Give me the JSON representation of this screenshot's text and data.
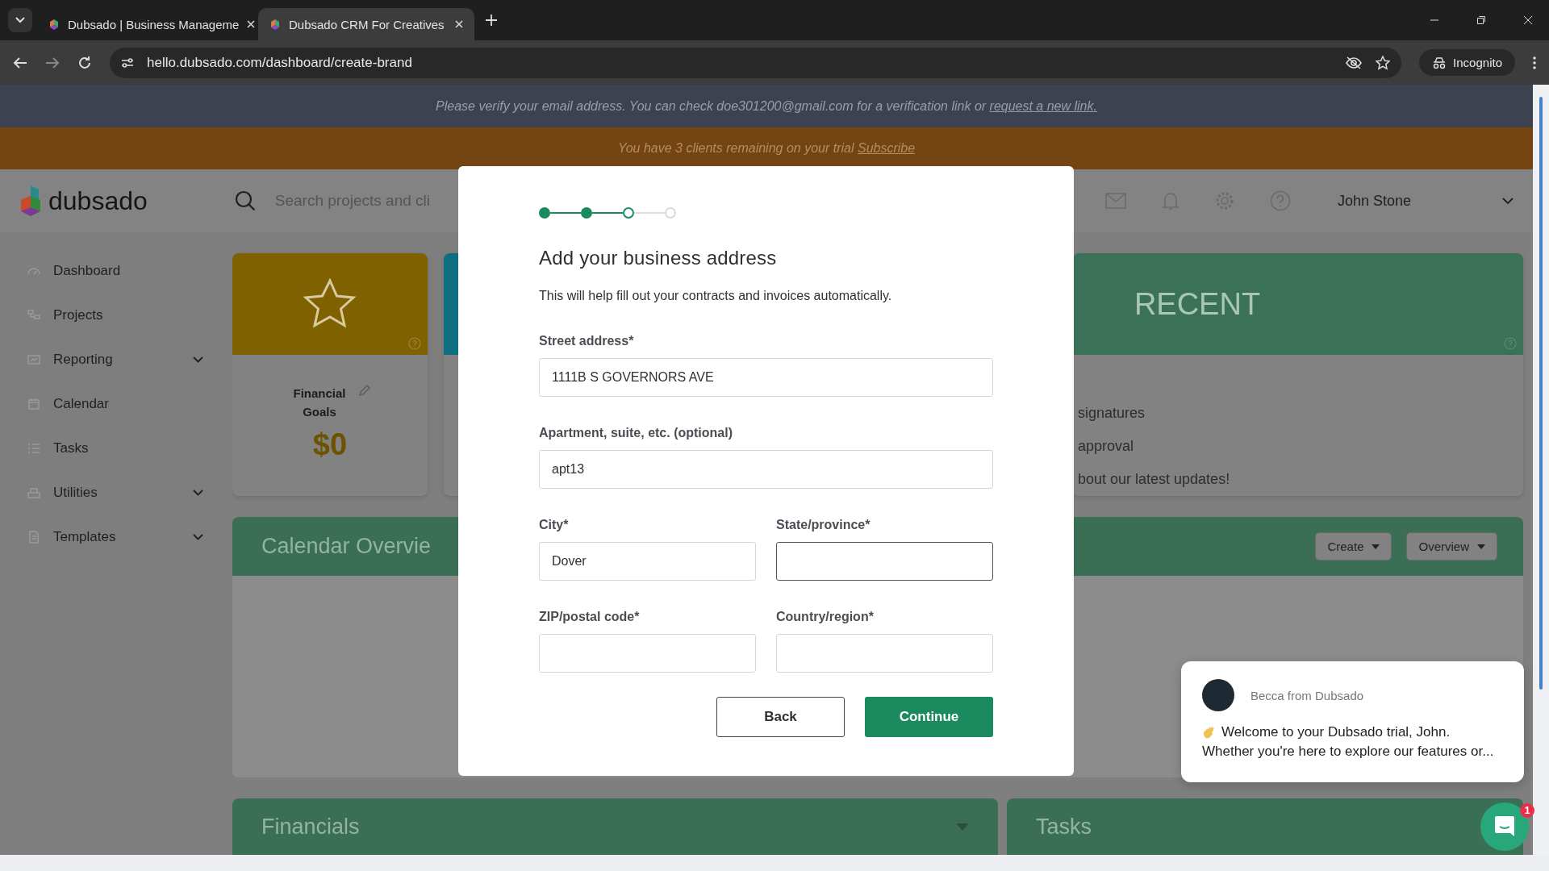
{
  "browser": {
    "tabs": [
      {
        "title": "Dubsado | Business Manageme",
        "selected": false
      },
      {
        "title": "Dubsado CRM For Creatives",
        "selected": true
      }
    ],
    "url": "hello.dubsado.com/dashboard/create-brand",
    "profile": "Incognito"
  },
  "verify_banner": {
    "text": "Please verify your email address. You can check doe301200@gmail.com for a verification link or ",
    "link": "request a new link."
  },
  "trial_banner": {
    "text": "You have 3 clients remaining on your trial ",
    "link": "Subscribe"
  },
  "header": {
    "logo": "dubsado",
    "search_placeholder": "Search projects and cli",
    "user": "John Stone"
  },
  "sidebar": {
    "items": [
      {
        "label": "Dashboard",
        "expandable": false
      },
      {
        "label": "Projects",
        "expandable": false
      },
      {
        "label": "Reporting",
        "expandable": true
      },
      {
        "label": "Calendar",
        "expandable": false
      },
      {
        "label": "Tasks",
        "expandable": false
      },
      {
        "label": "Utilities",
        "expandable": true
      },
      {
        "label": "Templates",
        "expandable": true
      }
    ]
  },
  "goal_card": {
    "title": "Financial Goals",
    "amount": "$0"
  },
  "recent_card": {
    "title": "RECENT",
    "items": [
      "signatures",
      "approval",
      "bout our latest updates!"
    ]
  },
  "calendar_panel": {
    "title": "Calendar Overvie",
    "buttons": [
      "Create",
      "Overview"
    ]
  },
  "bottom_panels": [
    "Financials",
    "Tasks"
  ],
  "modal": {
    "steps": [
      {
        "completed": true,
        "current": false
      },
      {
        "completed": true,
        "current": false
      },
      {
        "completed": false,
        "current": true
      },
      {
        "completed": false,
        "current": false
      }
    ],
    "title": "Add your business address",
    "subtitle": "This will help fill out your contracts and invoices automatically.",
    "fields": [
      {
        "label": "Street address*",
        "value": "1111B S GOVERNORS AVE",
        "focused": false
      },
      {
        "label": "Apartment, suite, etc. (optional)",
        "value": "apt13",
        "focused": false
      },
      {
        "label": "City*",
        "value": "Dover",
        "focused": false
      },
      {
        "label": "State/province*",
        "focused": true
      },
      {
        "label": "ZIP/postal code*",
        "focused": false
      },
      {
        "label": "Country/region*",
        "focused": false
      }
    ],
    "back": "Back",
    "continue": "Continue"
  },
  "chat": {
    "sender": "Becca from Dubsado",
    "lines": [
      "Welcome to your Dubsado trial, John.",
      "Whether you're here to explore our features or..."
    ],
    "badge": "1"
  }
}
